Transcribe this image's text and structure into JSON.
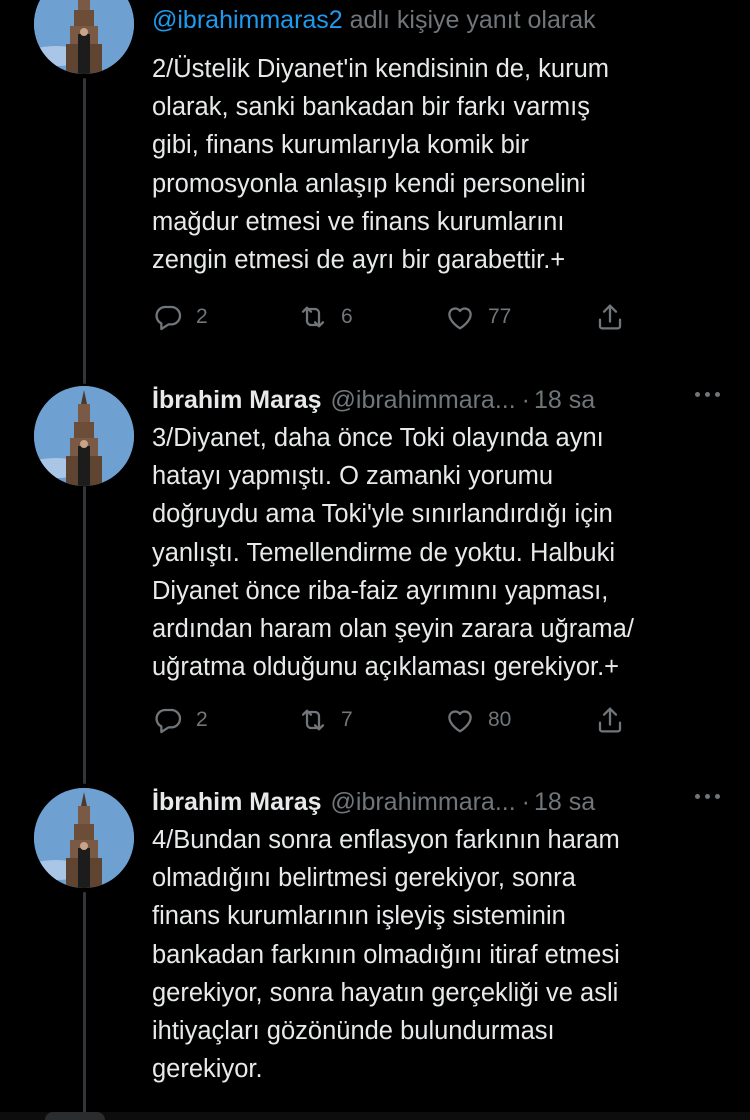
{
  "reply_context": {
    "mention": "@ibrahimmaras2",
    "suffix": " adlı kişiye yanıt olarak"
  },
  "tweets": [
    {
      "text": "2/Üstelik Diyanet'in kendisinin de, kurum\nolarak, sanki bankadan bir farkı varmış\ngibi, finans kurumlarıyla komik bir\npromosyonla anlaşıp kendi personelini\nmağdur etmesi ve finans kurumlarını\nzengin etmesi de ayrı bir garabettir.+",
      "replies": "2",
      "retweets": "6",
      "likes": "77"
    },
    {
      "display_name": "İbrahim Maraş",
      "handle": "@ibrahimmara...",
      "separator": "·",
      "time": "18 sa",
      "text": "3/Diyanet, daha önce Toki olayında aynı\nhatayı yapmıştı. O zamanki yorumu\ndoğruydu ama Toki'yle sınırlandırdığı için\nyanlıştı. Temellendirme de yoktu. Halbuki\nDiyanet önce riba-faiz ayrımını yapması,\nardından haram olan şeyin zarara uğrama/\nuğratma olduğunu açıklaması gerekiyor.+",
      "replies": "2",
      "retweets": "7",
      "likes": "80"
    },
    {
      "display_name": "İbrahim Maraş",
      "handle": "@ibrahimmara...",
      "separator": "·",
      "time": "18 sa",
      "text": "4/Bundan sonra enflasyon farkının haram\nolmadığını belirtmesi gerekiyor, sonra\nfinans kurumlarının işleyiş sisteminin\nbankadan farkının olmadığını itiraf etmesi\ngerekiyor, sonra hayatın gerçekliği ve asli\nihtiyaçları gözönünde bulundurması\ngerekiyor."
    }
  ],
  "colors": {
    "background": "#000000",
    "text_primary": "#e7e9ea",
    "text_secondary": "#71767b",
    "link": "#1d9bf0",
    "thread_line": "#333639"
  },
  "icons": {
    "reply": "reply-icon",
    "retweet": "retweet-icon",
    "like": "heart-icon",
    "share": "share-icon",
    "more": "more-icon"
  }
}
